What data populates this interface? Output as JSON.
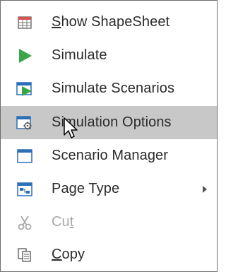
{
  "menu": {
    "items": [
      {
        "label_pre": "",
        "label_ul": "S",
        "label_post": "how ShapeSheet",
        "icon": "shapesheet-icon",
        "enabled": true,
        "submenu": false
      },
      {
        "label_pre": "",
        "label_ul": "",
        "label_post": "Simulate",
        "icon": "play-icon",
        "enabled": true,
        "submenu": false
      },
      {
        "label_pre": "",
        "label_ul": "",
        "label_post": "Simulate Scenarios",
        "icon": "simulate-scenarios-icon",
        "enabled": true,
        "submenu": false
      },
      {
        "label_pre": "",
        "label_ul": "",
        "label_post": "Simulation Options",
        "icon": "simulation-options-icon",
        "enabled": true,
        "submenu": false,
        "hovered": true
      },
      {
        "label_pre": "",
        "label_ul": "",
        "label_post": "Scenario Manager",
        "icon": "scenario-manager-icon",
        "enabled": true,
        "submenu": false
      },
      {
        "label_pre": "",
        "label_ul": "",
        "label_post": "Page Type",
        "icon": "page-type-icon",
        "enabled": true,
        "submenu": true
      },
      {
        "label_pre": "Cu",
        "label_ul": "t",
        "label_post": "",
        "icon": "scissors-icon",
        "enabled": false,
        "submenu": false
      },
      {
        "label_pre": "",
        "label_ul": "C",
        "label_post": "opy",
        "icon": "copy-icon",
        "enabled": true,
        "submenu": false
      }
    ]
  },
  "colors": {
    "hover_bg": "#c8c8c8",
    "text": "#2b2b2b",
    "disabled_text": "#a8a8a8",
    "accent_green": "#3aa64a",
    "accent_blue": "#2a6fb8"
  }
}
